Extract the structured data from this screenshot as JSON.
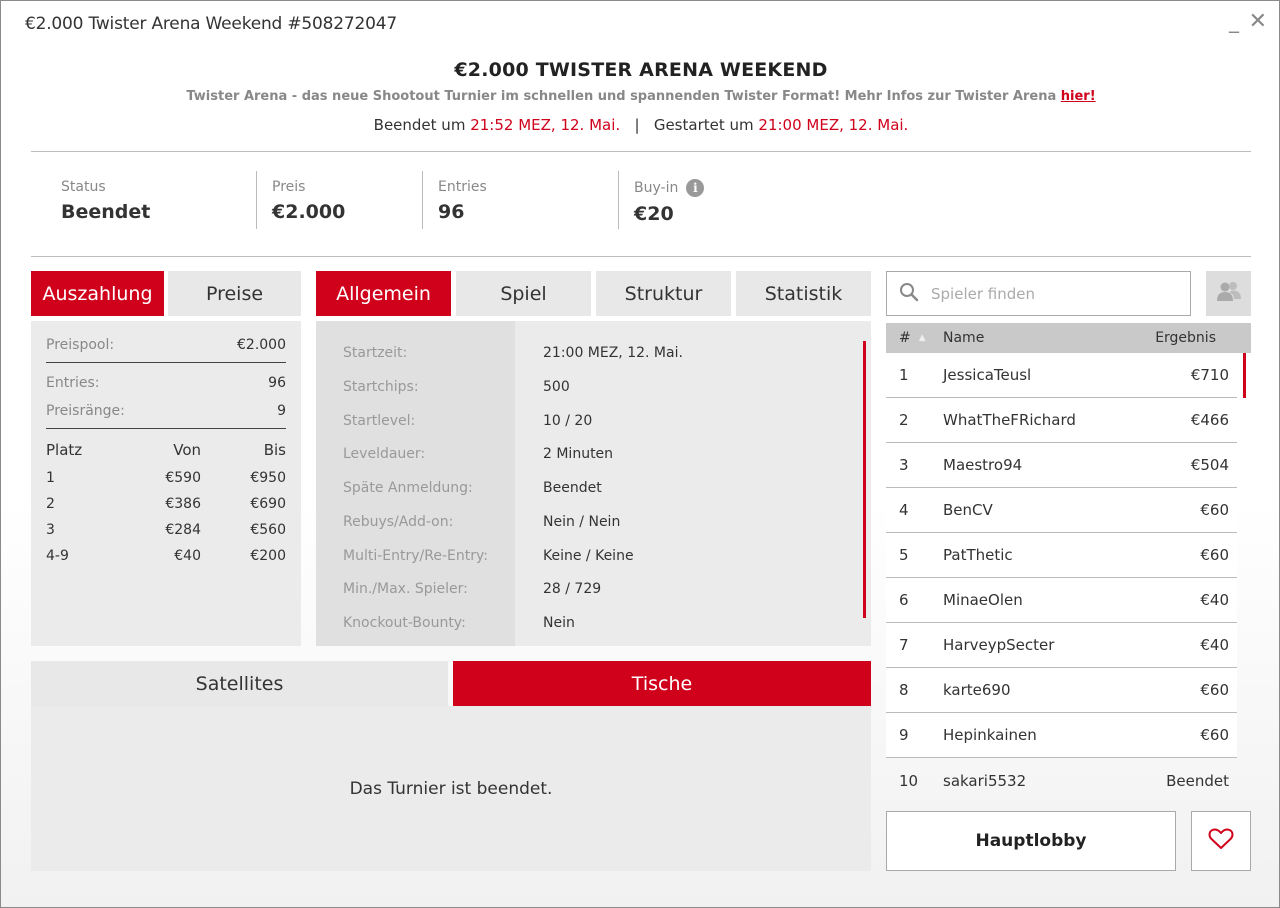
{
  "window": {
    "title": "€2.000 Twister Arena Weekend #508272047",
    "minimize": "_",
    "close": "✕"
  },
  "header": {
    "title": "€2.000 TWISTER ARENA WEEKEND",
    "subtitle": "Twister Arena - das neue Shootout Turnier im schnellen und spannenden Twister Format! Mehr Infos zur Twister Arena",
    "link": "hier!",
    "ended_label": "Beendet um",
    "ended_time": "21:52 MEZ, 12. Mai.",
    "separator": "|",
    "started_label": "Gestartet um",
    "started_time": "21:00 MEZ, 12. Mai."
  },
  "stats": [
    {
      "label": "Status",
      "value": "Beendet"
    },
    {
      "label": "Preis",
      "value": "€2.000"
    },
    {
      "label": "Entries",
      "value": "96"
    },
    {
      "label": "Buy-in",
      "value": "€20",
      "info": "i"
    }
  ],
  "left_tabs": [
    {
      "label": "Auszahlung",
      "active": true
    },
    {
      "label": "Preise",
      "active": false
    }
  ],
  "payout": {
    "pool_label": "Preispool:",
    "pool_value": "€2.000",
    "entries_label": "Entries:",
    "entries_value": "96",
    "ranks_label": "Preisränge:",
    "ranks_value": "9",
    "columns": [
      "Platz",
      "Von",
      "Bis"
    ],
    "rows": [
      [
        "1",
        "€590",
        "€950"
      ],
      [
        "2",
        "€386",
        "€690"
      ],
      [
        "3",
        "€284",
        "€560"
      ],
      [
        "4-9",
        "€40",
        "€200"
      ]
    ]
  },
  "mid_tabs": [
    {
      "label": "Allgemein",
      "active": true
    },
    {
      "label": "Spiel",
      "active": false
    },
    {
      "label": "Struktur",
      "active": false
    },
    {
      "label": "Statistik",
      "active": false
    }
  ],
  "general": [
    {
      "label": "Startzeit:",
      "value": "21:00 MEZ, 12. Mai."
    },
    {
      "label": "Startchips:",
      "value": "500"
    },
    {
      "label": "Startlevel:",
      "value": "10 / 20"
    },
    {
      "label": "Leveldauer:",
      "value": "2 Minuten"
    },
    {
      "label": "Späte Anmeldung:",
      "value": "Beendet"
    },
    {
      "label": "Rebuys/Add-on:",
      "value": "Nein / Nein"
    },
    {
      "label": "Multi-Entry/Re-Entry:",
      "value": "Keine / Keine"
    },
    {
      "label": "Min./Max. Spieler:",
      "value": "28 / 729"
    },
    {
      "label": "Knockout-Bounty:",
      "value": "Nein"
    }
  ],
  "bottom_tabs": [
    {
      "label": "Satellites",
      "active": false
    },
    {
      "label": "Tische",
      "active": true
    }
  ],
  "bottom_message": "Das Turnier ist beendet.",
  "search": {
    "placeholder": "Spieler finden"
  },
  "players_header": {
    "num": "#",
    "name": "Name",
    "result": "Ergebnis"
  },
  "players": [
    {
      "n": "1",
      "name": "JessicaTeusl",
      "result": "€710"
    },
    {
      "n": "2",
      "name": "WhatTheFRichard",
      "result": "€466"
    },
    {
      "n": "3",
      "name": "Maestro94",
      "result": "€504"
    },
    {
      "n": "4",
      "name": "BenCV",
      "result": "€60"
    },
    {
      "n": "5",
      "name": "PatThetic",
      "result": "€60"
    },
    {
      "n": "6",
      "name": "MinaeOlen",
      "result": "€40"
    },
    {
      "n": "7",
      "name": "HarveypSecter",
      "result": "€40"
    },
    {
      "n": "8",
      "name": "karte690",
      "result": "€60"
    },
    {
      "n": "9",
      "name": "Hepinkainen",
      "result": "€60"
    },
    {
      "n": "10",
      "name": "sakari5532",
      "result": "Beendet"
    }
  ],
  "buttons": {
    "lobby": "Hauptlobby"
  },
  "colors": {
    "accent": "#d0021b"
  }
}
